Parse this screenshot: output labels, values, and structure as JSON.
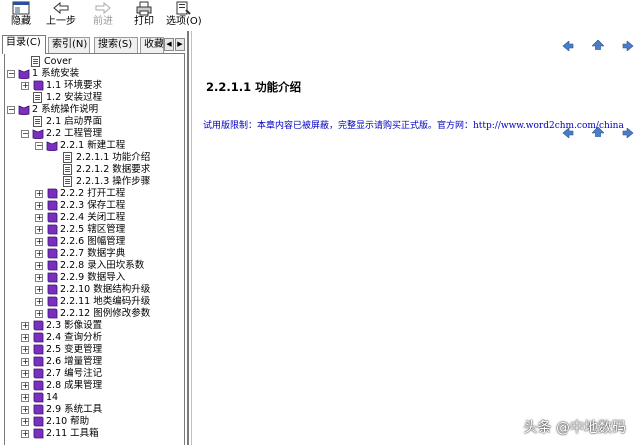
{
  "toolbar": {
    "hide": "隐藏",
    "back": "上一步",
    "forward": "前进",
    "print": "打印",
    "options": "选项(O)"
  },
  "tabs": {
    "contents": "目录(C)",
    "index": "索引(N)",
    "search": "搜索(S)",
    "favorites": "收藏"
  },
  "tree": [
    {
      "label": "Cover"
    },
    {
      "label": "1 系统安装"
    },
    {
      "label": "1.1 环境要求"
    },
    {
      "label": "1.2 安装过程"
    },
    {
      "label": "2 系统操作说明"
    },
    {
      "label": "2.1 启动界面"
    },
    {
      "label": "2.2 工程管理"
    },
    {
      "label": "2.2.1 新建工程"
    },
    {
      "label": "2.2.1.1 功能介绍"
    },
    {
      "label": "2.2.1.2 数据要求"
    },
    {
      "label": "2.2.1.3 操作步骤"
    },
    {
      "label": "2.2.2 打开工程"
    },
    {
      "label": "2.2.3 保存工程"
    },
    {
      "label": "2.2.4 关闭工程"
    },
    {
      "label": "2.2.5 辖区管理"
    },
    {
      "label": "2.2.6 图幅管理"
    },
    {
      "label": "2.2.7 数据字典"
    },
    {
      "label": "2.2.8 录入田坎系数"
    },
    {
      "label": "2.2.9 数据导入"
    },
    {
      "label": "2.2.10 数据结构升级"
    },
    {
      "label": "2.2.11 地类编码升级"
    },
    {
      "label": "2.2.12 图例修改参数"
    },
    {
      "label": "2.3 影像设置"
    },
    {
      "label": "2.4 查询分析"
    },
    {
      "label": "2.5 变更管理"
    },
    {
      "label": "2.6 增量管理"
    },
    {
      "label": "2.7 编号注记"
    },
    {
      "label": "2.8 成果管理"
    },
    {
      "label": "14"
    },
    {
      "label": "2.9 系统工具"
    },
    {
      "label": "2.10 帮助"
    },
    {
      "label": "2.11 工具箱"
    }
  ],
  "content": {
    "title": "2.2.1.1 功能介绍",
    "trial_notice": "试用版限制：本章内容已被屏蔽，完整显示请购买正式版。官方网：http://www.word2chm.com/china"
  },
  "watermark": "头条 @中地数码",
  "colors": {
    "book": "#7b2fbe",
    "link": "#0000c0",
    "nav_arrow": "#4a7fc8"
  }
}
